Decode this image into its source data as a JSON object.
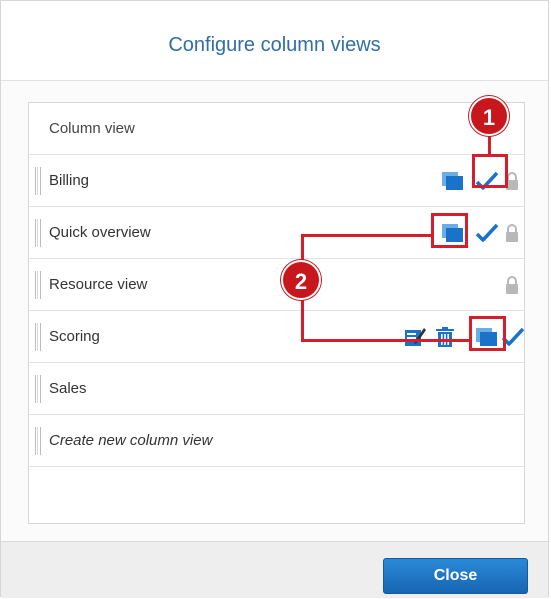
{
  "dialog": {
    "title": "Configure column views",
    "close_label": "Close"
  },
  "table": {
    "header": "Column view",
    "rows": [
      {
        "label": "Billing",
        "italic": false,
        "icons": [
          "copy-icon",
          "checkmark-icon",
          "lock-icon"
        ]
      },
      {
        "label": "Quick overview",
        "italic": false,
        "icons": [
          "copy-icon",
          "checkmark-icon",
          "lock-icon"
        ]
      },
      {
        "label": "Resource view",
        "italic": false,
        "icons": [
          "lock-icon"
        ]
      },
      {
        "label": "Scoring",
        "italic": false,
        "icons": [
          "edit-icon",
          "trash-icon",
          "copy-icon",
          "checkmark-icon"
        ]
      },
      {
        "label": "Sales",
        "italic": false,
        "icons": []
      },
      {
        "label": "Create new column view",
        "italic": true,
        "icons": []
      }
    ]
  },
  "callouts": {
    "one": "1",
    "two": "2"
  },
  "colors": {
    "accent": "#1a73c8",
    "callout": "#d41e2b",
    "lock": "#b8b8b8"
  }
}
